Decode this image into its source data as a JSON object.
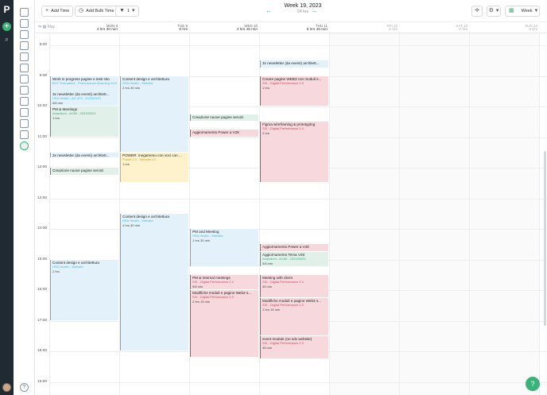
{
  "sidebar": {
    "logo": "P",
    "add": "+",
    "search": "⌕"
  },
  "toolbar": {
    "add_time": "Add Time",
    "add_bulk_time": "Add Bulk Time",
    "filter_count": "1",
    "week_title": "Week 19, 2023",
    "week_total": "24 hrs",
    "view": "Week"
  },
  "icons": {
    "plus": "+",
    "clock": "◷",
    "filter": "▼",
    "prev": "←",
    "next": "→",
    "crosshair": "✛",
    "gear": "⚙",
    "calendar": "▦",
    "chevron": "▾",
    "chat": "?"
  },
  "days": [
    {
      "date": "MON 8",
      "hours": "4 hrs 30 min",
      "weekend": false
    },
    {
      "date": "TUE 9",
      "hours": "8 hrs",
      "weekend": false
    },
    {
      "date": "WED 10",
      "hours": "4 hrs 45 min",
      "weekend": false
    },
    {
      "date": "THU 11",
      "hours": "6 hrs 45 min",
      "weekend": false
    },
    {
      "date": "FRI 12",
      "hours": "0 hrs",
      "weekend": true
    },
    {
      "date": "SAT 13",
      "hours": "0 hrs",
      "weekend": true
    },
    {
      "date": "SUN 14",
      "hours": "0 hrs",
      "weekend": true
    }
  ],
  "month_label": "May",
  "hours": [
    "8:00",
    "9:00",
    "10:00",
    "11:00",
    "12:00",
    "13:00",
    "14:00",
    "15:00",
    "16:00",
    "17:00",
    "18:00",
    "19:00"
  ],
  "events": [
    {
      "day": 0,
      "start": 9.0,
      "end": 10.0,
      "color": "blue",
      "title": "Work in progress pagine e testi sito",
      "project": "BGT Sheraatica - Performance Branding 23-02",
      "duration": ""
    },
    {
      "day": 0,
      "start": 9.5,
      "end": 10.0,
      "color": "blue",
      "title": "3x newsletter (da eventi) architett...",
      "project": "HSA Health - AC-023 - 2023/03/21",
      "duration": "5/6 min"
    },
    {
      "day": 0,
      "start": 10.0,
      "end": 11.0,
      "color": "green",
      "title": "PM & Meetings",
      "project": "Ampullum - AC80 - 2023/03/21",
      "duration": "1 hrs"
    },
    {
      "day": 0,
      "start": 11.5,
      "end": 11.7,
      "color": "blue",
      "title": "3x newsletter (da eventi) architett...",
      "project": "",
      "duration": ""
    },
    {
      "day": 0,
      "start": 12.0,
      "end": 12.25,
      "color": "green",
      "title": "Creazione nuove pagine servizi",
      "project": "",
      "duration": ""
    },
    {
      "day": 0,
      "start": 15.0,
      "end": 17.0,
      "color": "blue",
      "title": "Content design e architettura",
      "project": "HSA Health - Website",
      "duration": "2 hrs"
    },
    {
      "day": 1,
      "start": 9.0,
      "end": 11.5,
      "color": "blue",
      "title": "Content design e architettura",
      "project": "HSA Health - Website",
      "duration": "2 hrs 30 min"
    },
    {
      "day": 1,
      "start": 11.5,
      "end": 12.5,
      "color": "yellow",
      "title": "POWER: megamenu con voci con ...",
      "project": "Power 2.0 - Website V2",
      "duration": "1 hrs"
    },
    {
      "day": 1,
      "start": 13.5,
      "end": 18.0,
      "color": "blue",
      "title": "Content design e architettura",
      "project": "HSA Health - Website",
      "duration": "4 hrs 30 min"
    },
    {
      "day": 2,
      "start": 10.25,
      "end": 10.5,
      "color": "green",
      "title": "Creazione nuove pagine servizi",
      "project": "",
      "duration": ""
    },
    {
      "day": 2,
      "start": 10.75,
      "end": 11.0,
      "color": "red",
      "title": "Aggiornamento Power a V28",
      "project": "",
      "duration": ""
    },
    {
      "day": 2,
      "start": 14.0,
      "end": 15.25,
      "color": "blue",
      "title": "PM and Meeting",
      "project": "HSA Health - Website",
      "duration": "1 hrs 30 min"
    },
    {
      "day": 2,
      "start": 15.5,
      "end": 16.0,
      "color": "red",
      "title": "PM & Internal meetings",
      "project": "SIX - Digital Performance 2.0",
      "duration": "5/6 min"
    },
    {
      "day": 2,
      "start": 16.0,
      "end": 18.2,
      "color": "red",
      "title": "Modifiche moduli e pagine Web3 s...",
      "project": "SIX - Digital Performance 2.0",
      "duration": "2 hrs 15 min"
    },
    {
      "day": 3,
      "start": 8.5,
      "end": 8.75,
      "color": "blue",
      "title": "3x newsletter (da eventi) architett...",
      "project": "",
      "duration": ""
    },
    {
      "day": 3,
      "start": 9.0,
      "end": 10.0,
      "color": "red",
      "title": "Creare pagine WEB3 con moduli s...",
      "project": "SIX - Digital Performance 2.0",
      "duration": "1 hrs"
    },
    {
      "day": 3,
      "start": 10.5,
      "end": 12.5,
      "color": "red",
      "title": "Figma wireframing & prototyping",
      "project": "SIX - Digital Performance 2.0",
      "duration": "2 hrs"
    },
    {
      "day": 3,
      "start": 14.5,
      "end": 14.75,
      "color": "red",
      "title": "Aggiornamento Power a V28",
      "project": "",
      "duration": ""
    },
    {
      "day": 3,
      "start": 14.75,
      "end": 15.25,
      "color": "green",
      "title": "Aggiornamento Tema V28",
      "project": "Ampullum - AC80 - 2023/03/21",
      "duration": "5/6 min"
    },
    {
      "day": 3,
      "start": 15.5,
      "end": 16.25,
      "color": "red",
      "title": "Meeting with client",
      "project": "SIX - Digital Performance 2.0",
      "duration": "45 min"
    },
    {
      "day": 3,
      "start": 16.25,
      "end": 17.5,
      "color": "red",
      "title": "Modifiche moduli e pagine Web3 s...",
      "project": "SIX - Digital Performance 2.0",
      "duration": "1 hrs 15 min"
    },
    {
      "day": 3,
      "start": 17.5,
      "end": 18.25,
      "color": "red",
      "title": "event module (on sdx website)",
      "project": "SIX - Digital Performance 2.0",
      "duration": "45 min"
    }
  ]
}
